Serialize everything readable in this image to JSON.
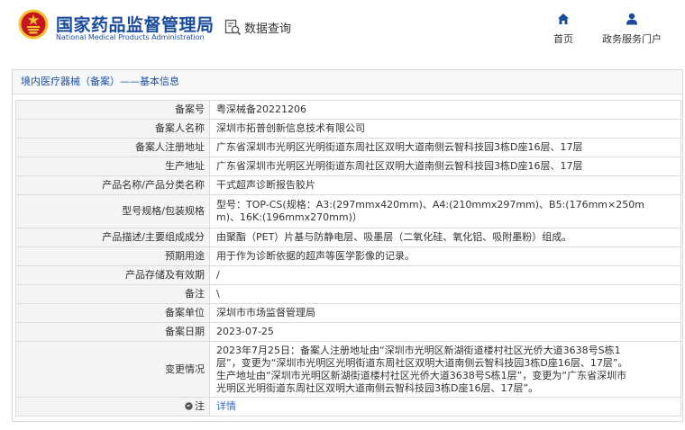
{
  "header": {
    "title_cn": "国家药品监督管理局",
    "title_en": "National Medical Products Administration",
    "query_label": "数据查询",
    "nav": {
      "home_label": "首页",
      "portal_label": "政务服务门户"
    },
    "colors": {
      "brand": "#1b4b9b",
      "emblem_red": "#c8161d",
      "emblem_gold": "#f2c230"
    }
  },
  "panel": {
    "breadcrumb": "境内医疗器械（备案）——基本信息"
  },
  "record": {
    "rows": [
      {
        "label": "备案号",
        "value": "粤深械备20221206"
      },
      {
        "label": "备案人名称",
        "value": "深圳市拓普创新信息技术有限公司"
      },
      {
        "label": "备案人注册地址",
        "value": "广东省深圳市光明区光明街道东周社区双明大道南侧云智科技园3栋D座16层、17层"
      },
      {
        "label": "生产地址",
        "value": "广东省深圳市光明区光明街道东周社区双明大道南侧云智科技园3栋D座16层、17层"
      },
      {
        "label": "产品名称/产品分类名称",
        "value": "干式超声诊断报告胶片"
      },
      {
        "label": "型号规格/包装规格",
        "value_lines": [
          "型号：TOP-CS(规格：A3:(297mmx420mm)、A4:(210mmx297mm)、B5:(176mm×250m",
          "m)、16K:(196mmx270mm)）"
        ]
      },
      {
        "label": "产品描述/主要组成成分",
        "value": "由聚酯（PET）片基与防静电层、吸墨层（二氧化硅、氧化铝、吸附墨粉）组成。"
      },
      {
        "label": "预期用途",
        "value": "用于作为诊断依据的超声等医学影像的记录。"
      },
      {
        "label": "产品存储及有效期",
        "value": "/"
      },
      {
        "label": "备注",
        "value": "\\"
      },
      {
        "label": "备案单位",
        "value": "深圳市市场监督管理局"
      },
      {
        "label": "备案日期",
        "value": "2023-07-25"
      },
      {
        "label": "变更情况",
        "value_lines": [
          "2023年7月25日：备案人注册地址由“深圳市光明区新湖街道楼村社区光侨大道3638号S栋1",
          "层”，变更为“深圳市光明区光明街道东周社区双明大道南侧云智科技园3栋D座16层、17层”。",
          "生产地址由“深圳市光明区新湖街道楼村社区光侨大道3638号S栋1层”，变更为“广东省深圳市",
          "光明区光明街道东周社区双明大道南侧云智科技园3栋D座16层、17层”。"
        ]
      },
      {
        "label": "注",
        "value": "详情",
        "icon": "notice-icon"
      }
    ]
  }
}
